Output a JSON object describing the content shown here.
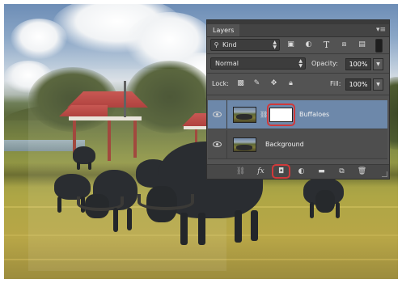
{
  "panel": {
    "title": "Layers",
    "menu_icon": "panel-menu-icon",
    "filter": {
      "label": "Kind",
      "icon": "search-icon"
    },
    "filter_icons": [
      "pixel-layer-filter-icon",
      "adjustment-layer-filter-icon",
      "type-layer-filter-icon",
      "shape-layer-filter-icon",
      "smart-object-filter-icon"
    ],
    "blend_mode": "Normal",
    "opacity": {
      "label": "Opacity:",
      "value": "100%"
    },
    "lock": {
      "label": "Lock:",
      "icons": [
        "lock-transparent-pixels-icon",
        "lock-image-pixels-icon",
        "lock-position-icon",
        "lock-all-icon"
      ]
    },
    "fill": {
      "label": "Fill:",
      "value": "100%"
    },
    "layers": [
      {
        "name": "Buffaloes",
        "selected": true,
        "has_mask": true
      },
      {
        "name": "Background",
        "selected": false,
        "has_mask": false
      }
    ],
    "bottom_icons": [
      "link-layers-icon",
      "layer-style-fx-icon",
      "add-layer-mask-icon",
      "adjustment-layer-icon",
      "new-group-icon",
      "new-layer-icon",
      "delete-layer-icon"
    ],
    "highlight_color": "#d0393a",
    "selection_color": "#6d88aa"
  }
}
